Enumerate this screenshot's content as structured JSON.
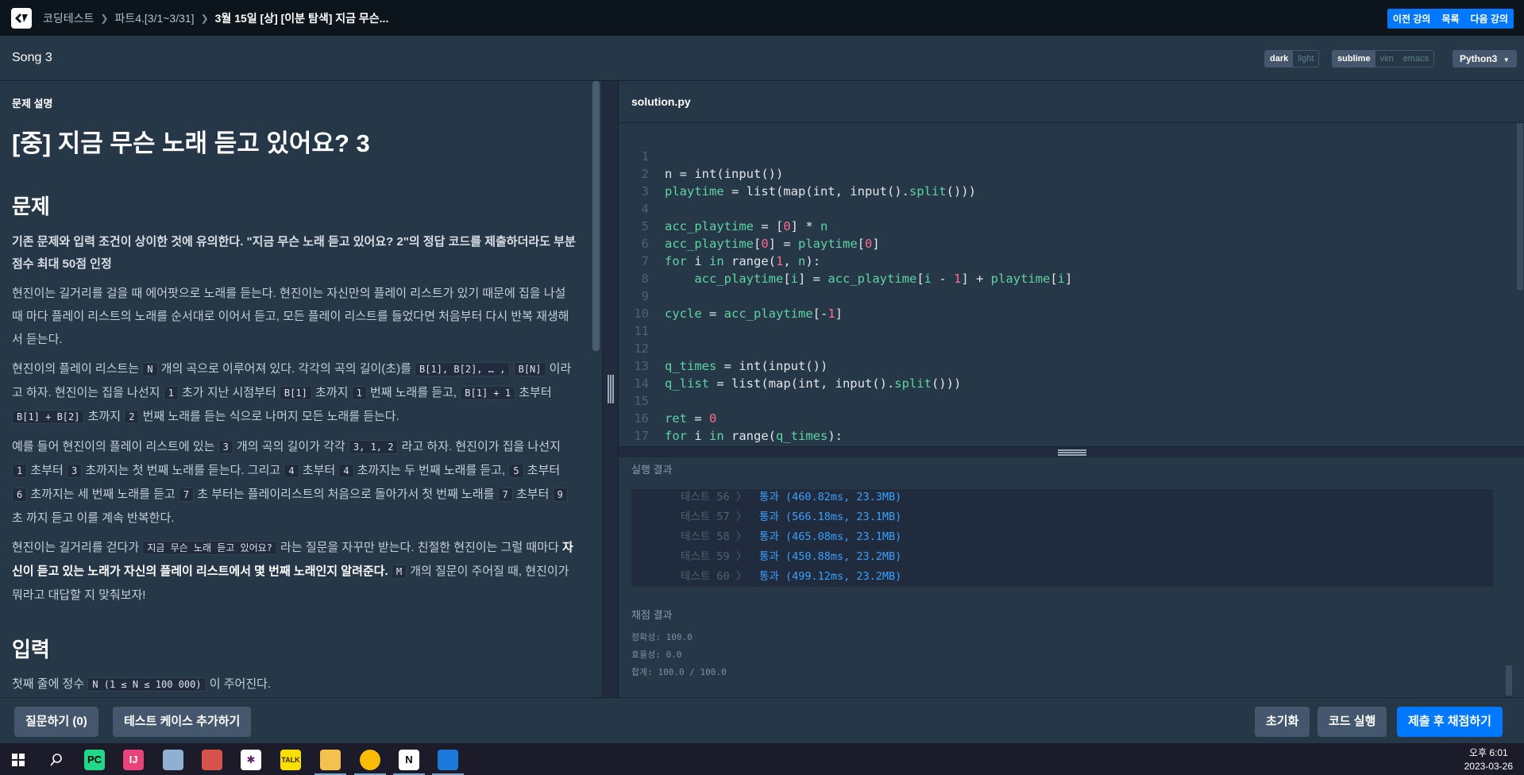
{
  "breadcrumbs": [
    "코딩테스트",
    "파트4.[3/1~3/31]",
    "3월 15일 [상] [이분 탐색] 지금 무슨..."
  ],
  "nav_buttons": [
    "이전 강의",
    "목록",
    "다음 강의"
  ],
  "problem_name": "Song 3",
  "theme": {
    "dark": "dark",
    "light": "light"
  },
  "keymap": {
    "sublime": "sublime",
    "vim": "vim",
    "emacs": "emacs"
  },
  "language": "Python3",
  "problem": {
    "section_label": "문제 설명",
    "title": "[중] 지금 무슨 노래 듣고 있어요? 3",
    "h_problem": "문제",
    "note": "기존 문제와 입력 조건이 상이한 것에 유의한다. \"지금 무슨 노래 듣고 있어요? 2\"의 정답 코드를 제출하더라도 부분 점수 최대 50점 인정",
    "p1": "현진이는 길거리를 걸을 때 에어팟으로 노래를 듣는다. 현진이는 자신만의 플레이 리스트가 있기 때문에 집을 나설 때 마다 플레이 리스트의 노래를 순서대로 이어서 듣고, 모든 플레이 리스트를 들었다면 처음부터 다시 반복 재생해서 듣는다.",
    "p2": {
      "a": "현진이의 플레이 리스트는 ",
      "c1": "N",
      "b": " 개의 곡으로 이루어져 있다. 각각의 곡의 길이(초)를 ",
      "c2": "B[1], B[2], … ,",
      "c3": "B[N]",
      "d": " 이라고 하자. 현진이는 집을 나선지 ",
      "c4": "1",
      "e": " 초가 지난 시점부터 ",
      "c5": "B[1]",
      "f": " 초까지 ",
      "c6": "1",
      "g": " 번째 노래를 듣고, ",
      "c7": "B[1] + 1",
      "h": " 초부터 ",
      "c8": "B[1] + B[2]",
      "i": " 초까지 ",
      "c9": "2",
      "j": " 번째 노래를 듣는 식으로 나머지 모든 노래를 듣는다."
    },
    "p3": {
      "a": "예를 들어 현진이의 플레이 리스트에 있는 ",
      "c1": "3",
      "b": " 개의 곡의 길이가 각각 ",
      "c2": "3, 1, 2",
      "c": " 라고 하자. 현진이가 집을 나선지 ",
      "c3": "1",
      "d": " 초부터 ",
      "c4": "3",
      "e": " 초까지는 첫 번째 노래를 듣는다. 그리고 ",
      "c5": "4",
      "f": " 초부터 ",
      "c6": "4",
      "g": " 초까지는 두 번째 노래를 듣고, ",
      "c7": "5",
      "h": " 초부터 ",
      "c8": "6",
      "i": " 초까지는 세 번째 노래를 듣고 ",
      "c9": "7",
      "j": " 초 부터는 플레이리스트의 처음으로 돌아가서 첫 번째 노래를 ",
      "c10": "7",
      "k": " 초부터 ",
      "c11": "9",
      "l": " 초 까지 듣고 이를 계속 반복한다."
    },
    "p4": {
      "a": "현진이는 길거리를 걷다가 ",
      "c1": "지금 무슨 노래 듣고 있어요?",
      "b": " 라는 질문을 자꾸만 받는다. 친절한 현진이는 그럴 때마다 ",
      "bold": "자신이 듣고 있는 노래가 자신의 플레이 리스트에서 몇 번째 노래인지 알려준다.",
      "c2": "M",
      "c": " 개의 질문이 주어질 때, 현진이가 뭐라고 대답할 지 맞춰보자!"
    },
    "h_input": "입력",
    "input_line": {
      "a": "첫째 줄에 정수 ",
      "c1": "N (1 ≤ N ≤ 100 000)",
      "b": " 이 주어진다."
    }
  },
  "editor": {
    "filename": "solution.py",
    "line_numbers": [
      "1",
      "2",
      "3",
      "4",
      "5",
      "6",
      "7",
      "8",
      "9",
      "10",
      "11",
      "12",
      "13",
      "14",
      "15",
      "16",
      "17"
    ]
  },
  "result": {
    "title": "실행 결과",
    "rows": [
      {
        "label": "테스트 56 〉",
        "status": "통과 (460.82ms, 23.3MB)"
      },
      {
        "label": "테스트 57 〉",
        "status": "통과 (566.18ms, 23.1MB)"
      },
      {
        "label": "테스트 58 〉",
        "status": "통과 (465.08ms, 23.1MB)"
      },
      {
        "label": "테스트 59 〉",
        "status": "통과 (450.88ms, 23.2MB)"
      },
      {
        "label": "테스트 60 〉",
        "status": "통과 (499.12ms, 23.2MB)"
      }
    ],
    "score_title": "채점 결과",
    "accuracy": "정확성: 100.0",
    "efficiency": "효율성: 0.0",
    "total": "합계: 100.0 / 100.0"
  },
  "buttons": {
    "question": "질문하기 (0)",
    "add_testcase": "테스트 케이스 추가하기",
    "reset": "초기화",
    "run": "코드 실행",
    "submit": "제출 후 채점하기"
  },
  "clock": {
    "time": "오후 6:01",
    "date": "2023-03-26"
  },
  "colors": {
    "accent": "#0078ff",
    "keyword": "#5fd3a2",
    "number": "#ff6b88",
    "pass": "#3aa0ff"
  }
}
